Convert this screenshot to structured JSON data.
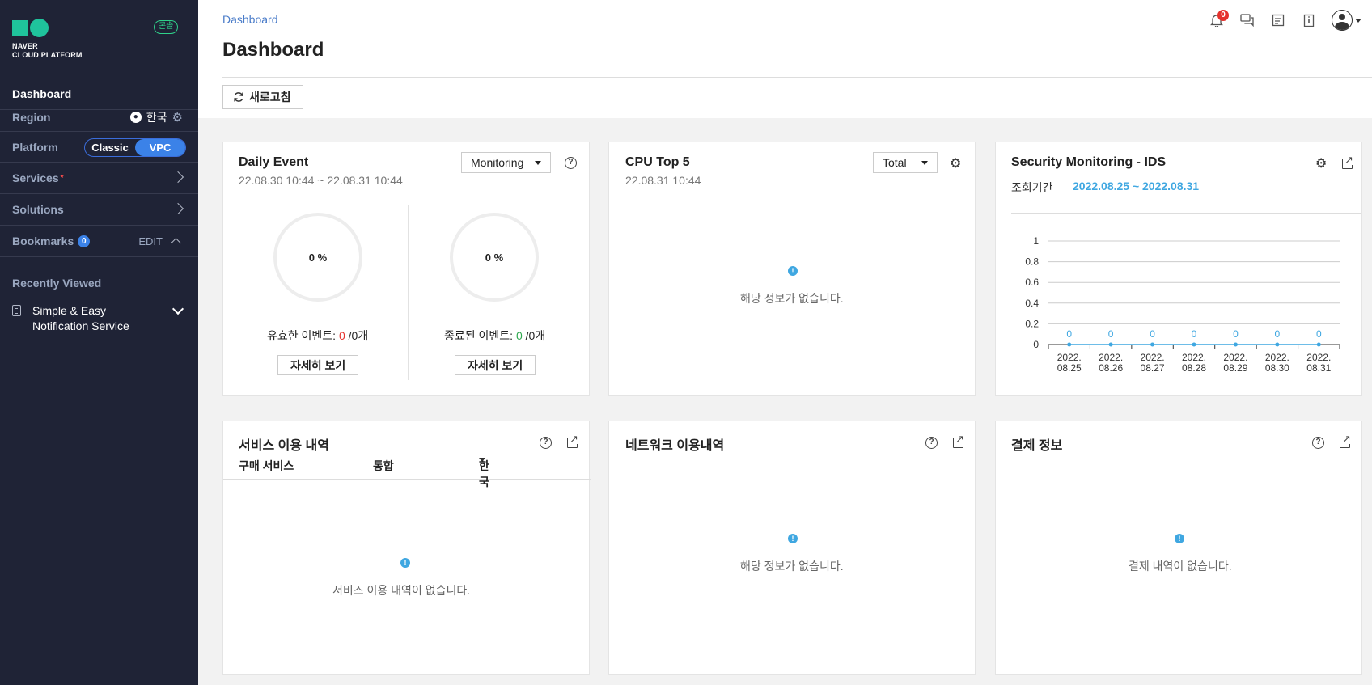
{
  "sidebar": {
    "logo_line1": "NAVER",
    "logo_line2": "CLOUD PLATFORM",
    "console_badge": "콘솔",
    "dashboard": "Dashboard",
    "region_label": "Region",
    "region_value": "한국",
    "platform_label": "Platform",
    "platform_options": [
      "Classic",
      "VPC"
    ],
    "platform_selected": "VPC",
    "services": "Services",
    "solutions": "Solutions",
    "bookmarks": "Bookmarks",
    "bookmarks_count": "0",
    "bookmarks_edit": "EDIT",
    "recently_viewed": "Recently Viewed",
    "recent_item_line1": "Simple & Easy",
    "recent_item_line2": "Notification Service"
  },
  "header": {
    "breadcrumb": "Dashboard",
    "title": "Dashboard",
    "refresh": "새로고침",
    "notification_count": "0"
  },
  "daily_event": {
    "title": "Daily Event",
    "range": "22.08.30 10:44 ~ 22.08.31 10:44",
    "select": "Monitoring",
    "left_pct": "0 %",
    "right_pct": "0 %",
    "valid_label": "유효한 이벤트: ",
    "valid_count": "0",
    "valid_total": " /0개",
    "closed_label": "종료된 이벤트: ",
    "closed_count": "0",
    "closed_total": " /0개",
    "detail_btn": "자세히 보기"
  },
  "cpu_top": {
    "title": "CPU Top 5",
    "time": "22.08.31 10:44",
    "select": "Total",
    "empty": "해당 정보가 없습니다."
  },
  "security": {
    "title": "Security Monitoring - IDS",
    "period_label": "조회기간",
    "period_value": "2022.08.25 ~ 2022.08.31"
  },
  "chart_data": {
    "type": "line",
    "x": [
      "2022.08.25",
      "2022.08.26",
      "2022.08.27",
      "2022.08.28",
      "2022.08.29",
      "2022.08.30",
      "2022.08.31"
    ],
    "x_labels_line1": [
      "2022.",
      "2022.",
      "2022.",
      "2022.",
      "2022.",
      "2022.",
      "2022."
    ],
    "x_labels_line2": [
      "08.25",
      "08.26",
      "08.27",
      "08.28",
      "08.29",
      "08.30",
      "08.31"
    ],
    "values": [
      0,
      0,
      0,
      0,
      0,
      0,
      0
    ],
    "yticks": [
      "0",
      "0.2",
      "0.4",
      "0.6",
      "0.8",
      "1"
    ],
    "ylim": [
      0,
      1
    ],
    "grid": true,
    "color": "#3fa7e1"
  },
  "service_usage": {
    "title": "서비스 이용 내역",
    "col1": "구매 서비스",
    "col2": "통합",
    "col3": "한국",
    "empty": "서비스 이용 내역이 없습니다."
  },
  "network": {
    "title": "네트워크 이용내역",
    "empty": "해당 정보가 없습니다."
  },
  "payment": {
    "title": "결제 정보",
    "empty": "결제 내역이 없습니다."
  },
  "colors": {
    "sidebar_bg": "#1f2336",
    "accent": "#3b82e8",
    "brand_green": "#1fc39c",
    "chart_blue": "#3fa7e1",
    "alert_red": "#e5322d"
  }
}
